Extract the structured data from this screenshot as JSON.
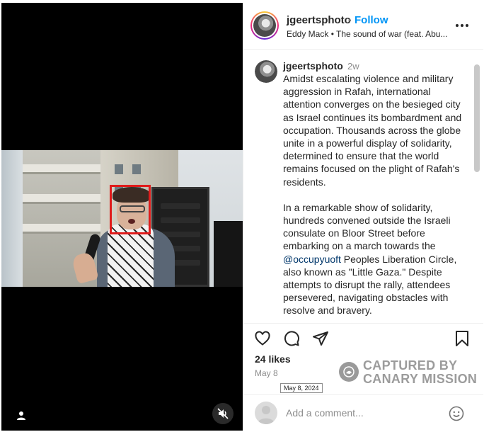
{
  "header": {
    "username": "jgeertsphoto",
    "separator": "•",
    "follow_label": "Follow",
    "audio": "Eddy Mack • The sound of war (feat. Abu..."
  },
  "caption": {
    "username": "jgeertsphoto",
    "time": "2w",
    "paragraph1": "Amidst escalating violence and military aggression in Rafah, international attention converges on the besieged city as Israel continues its bombardment and occupation. Thousands across the globe unite in a powerful display of solidarity, determined to ensure that the world remains focused on the plight of Rafah's residents.",
    "paragraph2_before": "In a remarkable show of solidarity, hundreds convened outside the Israeli consulate on Bloor Street before embarking on a march towards the ",
    "mention": "@occupyuoft",
    "paragraph2_after": " Peoples Liberation Circle, also known as \"Little Gaza.\" Despite attempts to disrupt the rally, attendees persevered, navigating obstacles with resolve and bravery."
  },
  "actions": {
    "like_icon": "heart-icon",
    "comment_icon": "comment-icon",
    "share_icon": "send-icon",
    "save_icon": "bookmark-icon"
  },
  "likes": "24 likes",
  "date": "May 8",
  "date_tooltip": "May 8, 2024",
  "watermark": {
    "line1": "CAPTURED BY",
    "line2": "CANARY MISSION"
  },
  "add_comment": {
    "placeholder": "Add a comment...",
    "emoji_icon": "smiley-icon"
  },
  "media": {
    "user_icon": "user-icon",
    "mute_icon": "muted-speaker-icon",
    "highlight_color": "#e01b1b"
  },
  "colors": {
    "accent": "#0095f6",
    "mention": "#00376b",
    "muted_text": "#8e8e8e"
  }
}
